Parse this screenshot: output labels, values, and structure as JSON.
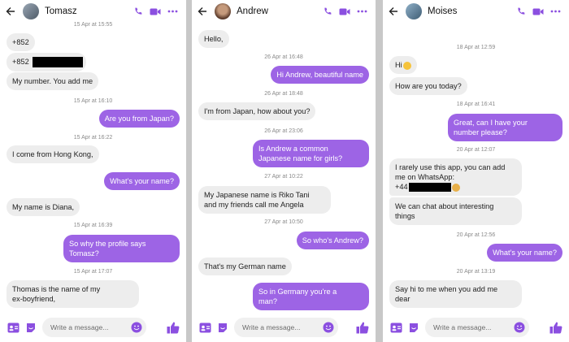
{
  "colors": {
    "accent": "#9d64e5",
    "incoming": "#ededed",
    "background": "#c8c8c8"
  },
  "placeholder": "Write a message...",
  "icons": [
    "back-arrow-icon",
    "phone-icon",
    "video-icon",
    "more-icon",
    "contact-card-icon",
    "sticker-icon",
    "emoji-icon",
    "thumbs-up-icon"
  ],
  "chats": [
    {
      "name": "Tomasz",
      "messages": [
        {
          "type": "date",
          "text": "15 Apr at 15:55"
        },
        {
          "type": "in",
          "text": "+852"
        },
        {
          "type": "in",
          "text": "+852"
        },
        {
          "type": "in",
          "text": "My number. You add me"
        },
        {
          "type": "date",
          "text": "15 Apr at 16:10"
        },
        {
          "type": "out",
          "text": "Are you from Japan?"
        },
        {
          "type": "date",
          "text": "15 Apr at 16:22"
        },
        {
          "type": "in",
          "text": "I come from Hong Kong,"
        },
        {
          "type": "out",
          "text": "What's your name?"
        },
        {
          "type": "in",
          "text": "My name is Diana,"
        },
        {
          "type": "date",
          "text": "15 Apr at 16:39"
        },
        {
          "type": "out",
          "text": "So why the profile says\nTomasz?"
        },
        {
          "type": "date",
          "text": "15 Apr at 17:07"
        },
        {
          "type": "in",
          "text": "Thomas is the name of my\nex-boyfriend,"
        }
      ]
    },
    {
      "name": "Andrew",
      "messages": [
        {
          "type": "in",
          "text": "Hello,"
        },
        {
          "type": "date",
          "text": "26 Apr at 16:48"
        },
        {
          "type": "out",
          "text": "Hi Andrew, beautiful name"
        },
        {
          "type": "date",
          "text": "26 Apr at 18:48"
        },
        {
          "type": "in",
          "text": "I'm from Japan, how about you?"
        },
        {
          "type": "date",
          "text": "26 Apr at 23:06"
        },
        {
          "type": "out",
          "text": "Is Andrew a common\nJapanese name for girls?"
        },
        {
          "type": "date",
          "text": "27 Apr at 10:22"
        },
        {
          "type": "in",
          "text": "My Japanese name is Riko Tani\nand my friends call me Angela"
        },
        {
          "type": "date",
          "text": "27 Apr at 10:50"
        },
        {
          "type": "out",
          "text": "So who's Andrew?"
        },
        {
          "type": "in",
          "text": "That's my German name"
        },
        {
          "type": "out",
          "text": "So in Germany you're a\nman?"
        }
      ]
    },
    {
      "name": "Moises",
      "messages": [
        {
          "type": "date",
          "text": "18 Apr at 12:59"
        },
        {
          "type": "in",
          "text": "Hi"
        },
        {
          "type": "in",
          "text": "How are you today?"
        },
        {
          "type": "date",
          "text": "18 Apr at 16:41"
        },
        {
          "type": "out",
          "text": "Great, can I have your\nnumber please?"
        },
        {
          "type": "date",
          "text": "20 Apr at 12:07"
        },
        {
          "type": "in",
          "text": "I rarely use this app, you can add\nme on WhatsApp:"
        },
        {
          "type": "in",
          "text": "+44"
        },
        {
          "type": "in",
          "text": "We can chat about interesting\nthings"
        },
        {
          "type": "date",
          "text": "20 Apr at 12:56"
        },
        {
          "type": "out",
          "text": "What's your name?"
        },
        {
          "type": "date",
          "text": "20 Apr at 13:19"
        },
        {
          "type": "in",
          "text": "Say hi to me when you add me\ndear"
        }
      ]
    }
  ]
}
